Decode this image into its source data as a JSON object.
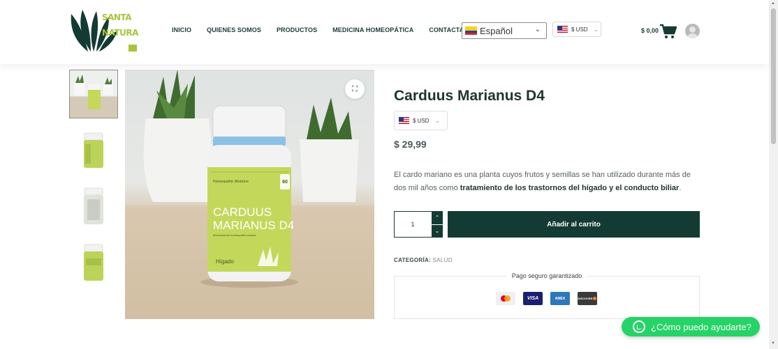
{
  "brand": {
    "logo_text_line1": "SANTA",
    "logo_text_line2": "NATURA",
    "logo_suffix": "LLC",
    "colors": {
      "primary": "#143b33",
      "accent": "#a7c43b",
      "whatsapp": "#25d366"
    }
  },
  "nav": {
    "items": [
      "INICIO",
      "QUIENES SOMOS",
      "PRODUCTOS",
      "MEDICINA HOMEOPÁTICA",
      "CONTACTANOS"
    ]
  },
  "language_select": {
    "selected": "Español",
    "flag_icon": "colombia-flag-icon"
  },
  "currency_select": {
    "selected": "$ USD",
    "flag_icon": "us-flag-icon"
  },
  "cart": {
    "total": "$ 0,00",
    "icon": "cart-icon"
  },
  "user": {
    "icon": "user-avatar-icon"
  },
  "gallery": {
    "thumbnails": [
      "thumbnail-1",
      "thumbnail-2",
      "thumbnail-3",
      "thumbnail-4"
    ],
    "main_image_label": {
      "brand_small": "Homeopathic Medicine",
      "count": "60",
      "count_unit": "tablets",
      "name_line1": "CARDUUS",
      "name_line2": "MARIANUS D4",
      "subtitle": "Medicamento homeopático natural",
      "organ": "Hígado"
    },
    "expand_icon": "expand-icon"
  },
  "product": {
    "title": "Carduus Marianus D4",
    "currency_selected": "$ USD",
    "price": "$ 29,99",
    "description_start": "El cardo mariano es una planta cuyos frutos y semillas se han utilizado durante más de dos mil años como ",
    "description_bold": "tratamiento de los trastornos del hígado y el conducto biliar",
    "description_end": ".",
    "quantity": "1",
    "add_to_cart": "Añadir al carrito",
    "category_label": "CATEGORÍA:",
    "category_value": "SALUD"
  },
  "secure": {
    "title": "Pago seguro garantizado",
    "cards": [
      {
        "name": "mastercard",
        "label": ""
      },
      {
        "name": "visa",
        "label": "VISA"
      },
      {
        "name": "amex",
        "label": "AMEX"
      },
      {
        "name": "discover",
        "label": "DISCOVER"
      }
    ]
  },
  "whatsapp": {
    "label": "¿Cómo puedo ayudarte?"
  }
}
